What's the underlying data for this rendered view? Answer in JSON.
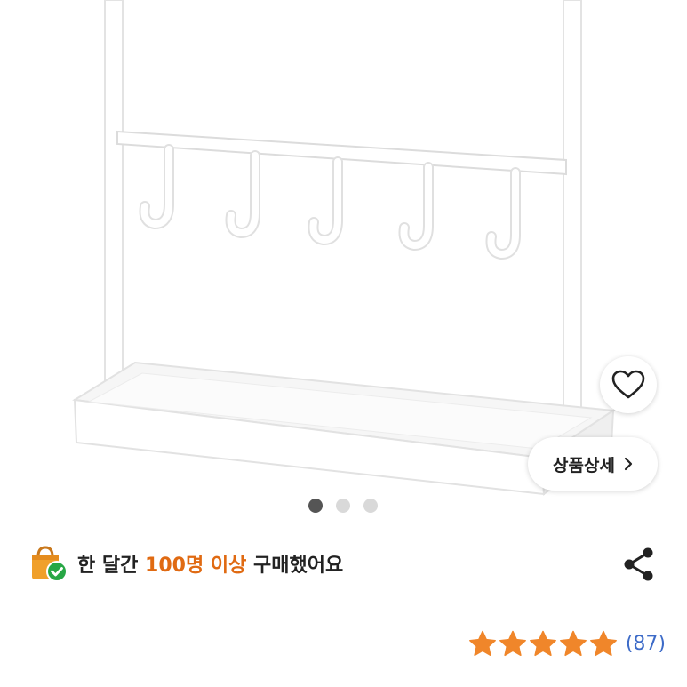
{
  "product": {
    "image_alt": "white hanger rack with five hooks",
    "detail_button_label": "상품상세",
    "carousel": {
      "count": 3,
      "active_index": 0
    }
  },
  "purchase_info": {
    "prefix": "한 달간 ",
    "highlight": "100명 이상",
    "suffix": " 구매했어요"
  },
  "rating": {
    "stars": 5,
    "review_count": "(87)"
  },
  "colors": {
    "accent": "#e06a12",
    "star": "#f0862a",
    "link": "#3d6bc8",
    "badge_green": "#27a745"
  },
  "icons": {
    "wish": "heart-icon",
    "share": "share-icon",
    "detail_arrow": "chevron-right-icon",
    "purchase": "shopping-bag-check-icon"
  }
}
